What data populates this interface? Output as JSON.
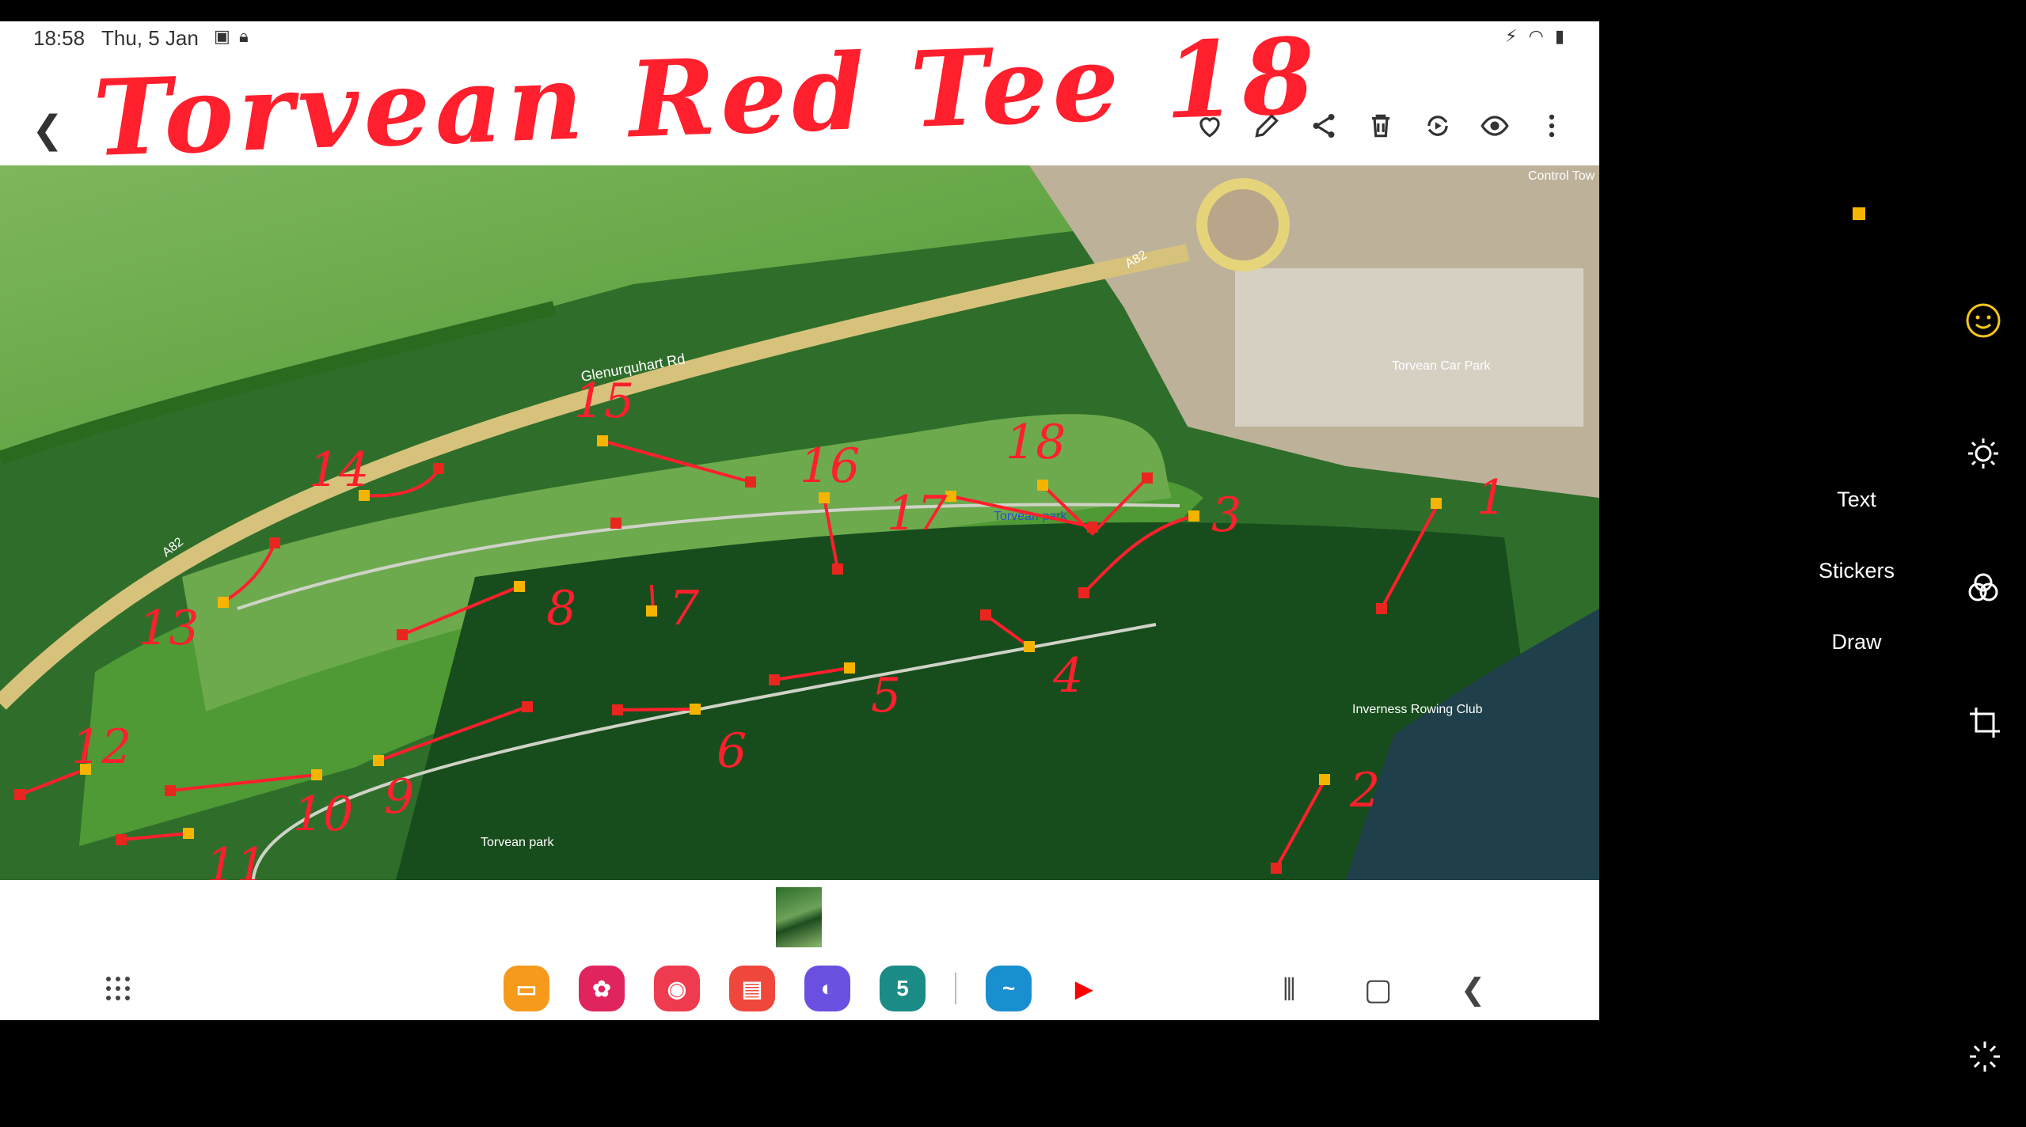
{
  "status_bar": {
    "time": "18:58",
    "date": "Thu, 5 Jan"
  },
  "toolbar": {
    "title": "Torvean Red Tee 18",
    "icons": [
      "back-icon",
      "heart-icon",
      "pencil-icon",
      "share-icon",
      "trash-icon",
      "rotate-icon",
      "eye-icon",
      "more-icon"
    ]
  },
  "map": {
    "labels": {
      "road1": "Glenurquhart Rd",
      "road2": "A82",
      "road3": "A82",
      "car_park": "Torvean Car Park",
      "park1": "Torvean park",
      "park2": "Torvean park",
      "rowing": "Inverness Rowing Club",
      "control": "Control Tow"
    },
    "hole_numbers": [
      "1",
      "2",
      "3",
      "4",
      "5",
      "6",
      "7",
      "8",
      "9",
      "10",
      "11",
      "12",
      "13",
      "14",
      "15",
      "16",
      "17",
      "18"
    ]
  },
  "side_menu": {
    "text": "Text",
    "stickers": "Stickers",
    "draw": "Draw"
  },
  "dock": {
    "calendar_day": "5"
  },
  "colors": {
    "ink": "#ff1f2d",
    "tee": "#f5b400",
    "basket": "#e8261f",
    "grass": "#3f8f2f",
    "forest": "#14451a"
  }
}
